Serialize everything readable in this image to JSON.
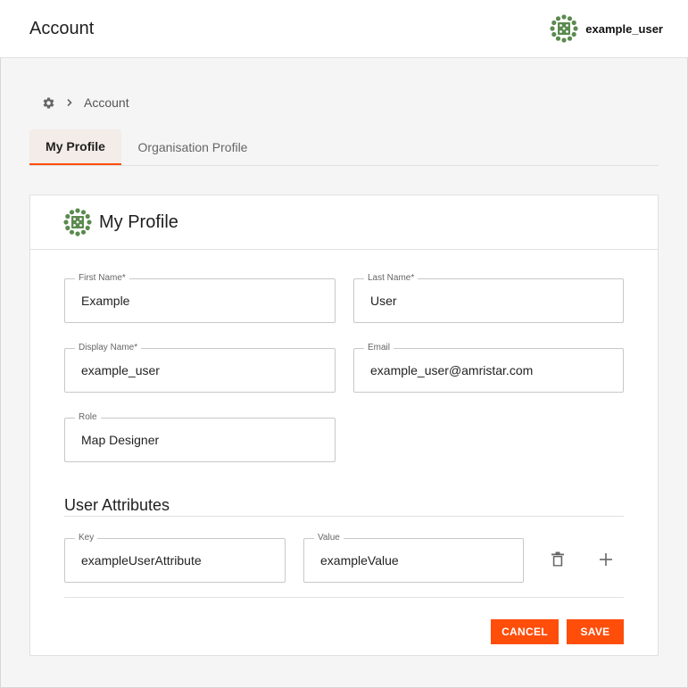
{
  "header": {
    "title": "Account",
    "username": "example_user",
    "avatar_icon": "green-dots-avatar-icon",
    "avatar_color": "#5b8a4f"
  },
  "breadcrumb": {
    "home_icon": "gear-icon",
    "separator_icon": "chevron-right-icon",
    "current": "Account"
  },
  "tabs": [
    {
      "label": "My Profile",
      "active": true
    },
    {
      "label": "Organisation Profile",
      "active": false
    }
  ],
  "profile": {
    "title": "My Profile",
    "fields": {
      "first_name": {
        "label": "First Name*",
        "value": "Example"
      },
      "last_name": {
        "label": "Last Name*",
        "value": "User"
      },
      "display_name": {
        "label": "Display Name*",
        "value": "example_user"
      },
      "email": {
        "label": "Email",
        "value": "example_user@amristar.com"
      },
      "role": {
        "label": "Role",
        "value": "Map Designer"
      }
    }
  },
  "attributes": {
    "title": "User Attributes",
    "rows": [
      {
        "key_label": "Key",
        "key": "exampleUserAttribute",
        "value_label": "Value",
        "value": "exampleValue"
      }
    ],
    "delete_icon": "trash-icon",
    "add_icon": "plus-icon"
  },
  "actions": {
    "cancel": "CANCEL",
    "save": "SAVE",
    "accent": "#ff4d0a"
  }
}
